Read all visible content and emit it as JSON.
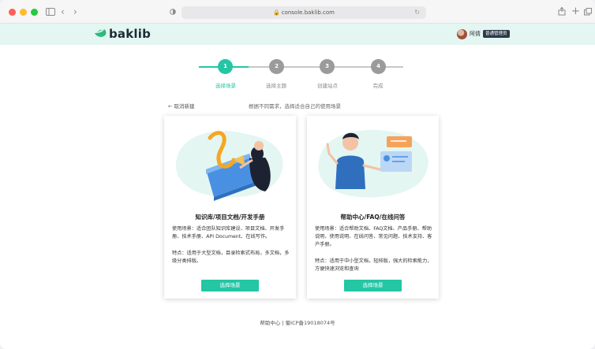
{
  "browser": {
    "url": "console.baklib.com"
  },
  "header": {
    "logo_text": "baklib",
    "user_name": "阿倩",
    "role_badge": "普通管理员"
  },
  "steps": [
    {
      "number": "1",
      "label": "选择场景",
      "active": true
    },
    {
      "number": "2",
      "label": "选择主题",
      "active": false
    },
    {
      "number": "3",
      "label": "创建站点",
      "active": false
    },
    {
      "number": "4",
      "label": "完成",
      "active": false
    }
  ],
  "nav": {
    "back_label": "← 取消新建",
    "subtitle": "根据不同需求，选择适合自己的使用场景"
  },
  "cards": [
    {
      "title": "知识库/项目文档/开发手册",
      "usage": "使用场景：适合团队知识库建设、项目文档、开发手册、技术手册、API Document、在线写作。",
      "feature": "特点：适用于大型文档，目录检索式布局，多文档，多级分类排版。",
      "button": "选择场景"
    },
    {
      "title": "帮助中心/FAQ/在线问答",
      "usage": "使用场景：适合帮助文档、FAQ文档、产品手册、帮助说明、使用说明、在线问答、常见问题、技术支持、客户手册。",
      "feature": "特点：适用于中小型文档，轻排版，强大的检索能力，方便快速浏览和查询",
      "button": "选择场景"
    }
  ],
  "footer": {
    "text": "帮助中心 | 蜀ICP备19018074号"
  },
  "colors": {
    "accent": "#24c6a4",
    "step_inactive": "#9b9b9b",
    "header_bg": "#e3f6f2"
  }
}
